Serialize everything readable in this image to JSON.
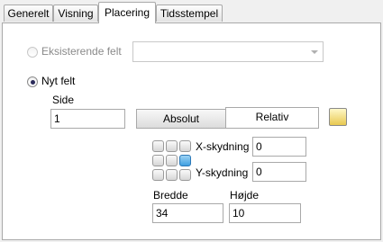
{
  "tabs": [
    "Generelt",
    "Visning",
    "Placering",
    "Tidsstempel"
  ],
  "existing_field_label": "Eksisterende felt",
  "new_field_label": "Nyt felt",
  "side_label": "Side",
  "side_value": "1",
  "segment": {
    "absolute": "Absolut",
    "relative": "Relativ"
  },
  "x_offset_label": "X-skydning",
  "x_offset_value": "0",
  "y_offset_label": "Y-skydning",
  "y_offset_value": "0",
  "width_label": "Bredde",
  "width_value": "34",
  "height_label": "Højde",
  "height_value": "10",
  "colors": {
    "selected_cell": "#3f9fe0"
  }
}
